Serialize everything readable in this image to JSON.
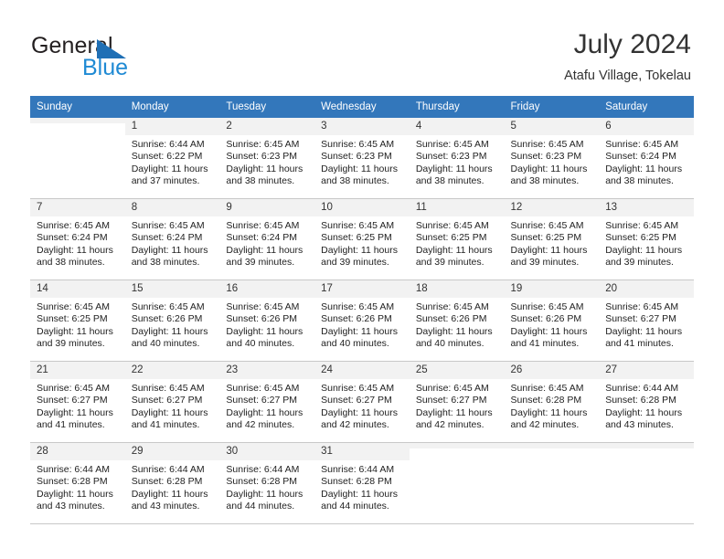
{
  "brand": {
    "name_part1": "General",
    "name_part2": "Blue",
    "logo_icon": "triangle-icon",
    "color_dark": "#231f20",
    "color_blue": "#1f8ad4",
    "triangle_color": "#1f6fb5"
  },
  "header": {
    "title": "July 2024",
    "subtitle": "Atafu Village, Tokelau"
  },
  "theme": {
    "header_row_bg": "#3377bb",
    "daynum_bg": "#f2f2f2",
    "grid_line": "#c8c8c8"
  },
  "weekdays": [
    {
      "label": "Sunday"
    },
    {
      "label": "Monday"
    },
    {
      "label": "Tuesday"
    },
    {
      "label": "Wednesday"
    },
    {
      "label": "Thursday"
    },
    {
      "label": "Friday"
    },
    {
      "label": "Saturday"
    }
  ],
  "weeks": [
    [
      {
        "day": "",
        "empty": true,
        "sunrise": "",
        "sunset": "",
        "daylight_line1": "",
        "daylight_line2": ""
      },
      {
        "day": "1",
        "sunrise": "Sunrise: 6:44 AM",
        "sunset": "Sunset: 6:22 PM",
        "daylight_line1": "Daylight: 11 hours",
        "daylight_line2": "and 37 minutes."
      },
      {
        "day": "2",
        "sunrise": "Sunrise: 6:45 AM",
        "sunset": "Sunset: 6:23 PM",
        "daylight_line1": "Daylight: 11 hours",
        "daylight_line2": "and 38 minutes."
      },
      {
        "day": "3",
        "sunrise": "Sunrise: 6:45 AM",
        "sunset": "Sunset: 6:23 PM",
        "daylight_line1": "Daylight: 11 hours",
        "daylight_line2": "and 38 minutes."
      },
      {
        "day": "4",
        "sunrise": "Sunrise: 6:45 AM",
        "sunset": "Sunset: 6:23 PM",
        "daylight_line1": "Daylight: 11 hours",
        "daylight_line2": "and 38 minutes."
      },
      {
        "day": "5",
        "sunrise": "Sunrise: 6:45 AM",
        "sunset": "Sunset: 6:23 PM",
        "daylight_line1": "Daylight: 11 hours",
        "daylight_line2": "and 38 minutes."
      },
      {
        "day": "6",
        "sunrise": "Sunrise: 6:45 AM",
        "sunset": "Sunset: 6:24 PM",
        "daylight_line1": "Daylight: 11 hours",
        "daylight_line2": "and 38 minutes."
      }
    ],
    [
      {
        "day": "7",
        "sunrise": "Sunrise: 6:45 AM",
        "sunset": "Sunset: 6:24 PM",
        "daylight_line1": "Daylight: 11 hours",
        "daylight_line2": "and 38 minutes."
      },
      {
        "day": "8",
        "sunrise": "Sunrise: 6:45 AM",
        "sunset": "Sunset: 6:24 PM",
        "daylight_line1": "Daylight: 11 hours",
        "daylight_line2": "and 38 minutes."
      },
      {
        "day": "9",
        "sunrise": "Sunrise: 6:45 AM",
        "sunset": "Sunset: 6:24 PM",
        "daylight_line1": "Daylight: 11 hours",
        "daylight_line2": "and 39 minutes."
      },
      {
        "day": "10",
        "sunrise": "Sunrise: 6:45 AM",
        "sunset": "Sunset: 6:25 PM",
        "daylight_line1": "Daylight: 11 hours",
        "daylight_line2": "and 39 minutes."
      },
      {
        "day": "11",
        "sunrise": "Sunrise: 6:45 AM",
        "sunset": "Sunset: 6:25 PM",
        "daylight_line1": "Daylight: 11 hours",
        "daylight_line2": "and 39 minutes."
      },
      {
        "day": "12",
        "sunrise": "Sunrise: 6:45 AM",
        "sunset": "Sunset: 6:25 PM",
        "daylight_line1": "Daylight: 11 hours",
        "daylight_line2": "and 39 minutes."
      },
      {
        "day": "13",
        "sunrise": "Sunrise: 6:45 AM",
        "sunset": "Sunset: 6:25 PM",
        "daylight_line1": "Daylight: 11 hours",
        "daylight_line2": "and 39 minutes."
      }
    ],
    [
      {
        "day": "14",
        "sunrise": "Sunrise: 6:45 AM",
        "sunset": "Sunset: 6:25 PM",
        "daylight_line1": "Daylight: 11 hours",
        "daylight_line2": "and 39 minutes."
      },
      {
        "day": "15",
        "sunrise": "Sunrise: 6:45 AM",
        "sunset": "Sunset: 6:26 PM",
        "daylight_line1": "Daylight: 11 hours",
        "daylight_line2": "and 40 minutes."
      },
      {
        "day": "16",
        "sunrise": "Sunrise: 6:45 AM",
        "sunset": "Sunset: 6:26 PM",
        "daylight_line1": "Daylight: 11 hours",
        "daylight_line2": "and 40 minutes."
      },
      {
        "day": "17",
        "sunrise": "Sunrise: 6:45 AM",
        "sunset": "Sunset: 6:26 PM",
        "daylight_line1": "Daylight: 11 hours",
        "daylight_line2": "and 40 minutes."
      },
      {
        "day": "18",
        "sunrise": "Sunrise: 6:45 AM",
        "sunset": "Sunset: 6:26 PM",
        "daylight_line1": "Daylight: 11 hours",
        "daylight_line2": "and 40 minutes."
      },
      {
        "day": "19",
        "sunrise": "Sunrise: 6:45 AM",
        "sunset": "Sunset: 6:26 PM",
        "daylight_line1": "Daylight: 11 hours",
        "daylight_line2": "and 41 minutes."
      },
      {
        "day": "20",
        "sunrise": "Sunrise: 6:45 AM",
        "sunset": "Sunset: 6:27 PM",
        "daylight_line1": "Daylight: 11 hours",
        "daylight_line2": "and 41 minutes."
      }
    ],
    [
      {
        "day": "21",
        "sunrise": "Sunrise: 6:45 AM",
        "sunset": "Sunset: 6:27 PM",
        "daylight_line1": "Daylight: 11 hours",
        "daylight_line2": "and 41 minutes."
      },
      {
        "day": "22",
        "sunrise": "Sunrise: 6:45 AM",
        "sunset": "Sunset: 6:27 PM",
        "daylight_line1": "Daylight: 11 hours",
        "daylight_line2": "and 41 minutes."
      },
      {
        "day": "23",
        "sunrise": "Sunrise: 6:45 AM",
        "sunset": "Sunset: 6:27 PM",
        "daylight_line1": "Daylight: 11 hours",
        "daylight_line2": "and 42 minutes."
      },
      {
        "day": "24",
        "sunrise": "Sunrise: 6:45 AM",
        "sunset": "Sunset: 6:27 PM",
        "daylight_line1": "Daylight: 11 hours",
        "daylight_line2": "and 42 minutes."
      },
      {
        "day": "25",
        "sunrise": "Sunrise: 6:45 AM",
        "sunset": "Sunset: 6:27 PM",
        "daylight_line1": "Daylight: 11 hours",
        "daylight_line2": "and 42 minutes."
      },
      {
        "day": "26",
        "sunrise": "Sunrise: 6:45 AM",
        "sunset": "Sunset: 6:28 PM",
        "daylight_line1": "Daylight: 11 hours",
        "daylight_line2": "and 42 minutes."
      },
      {
        "day": "27",
        "sunrise": "Sunrise: 6:44 AM",
        "sunset": "Sunset: 6:28 PM",
        "daylight_line1": "Daylight: 11 hours",
        "daylight_line2": "and 43 minutes."
      }
    ],
    [
      {
        "day": "28",
        "sunrise": "Sunrise: 6:44 AM",
        "sunset": "Sunset: 6:28 PM",
        "daylight_line1": "Daylight: 11 hours",
        "daylight_line2": "and 43 minutes."
      },
      {
        "day": "29",
        "sunrise": "Sunrise: 6:44 AM",
        "sunset": "Sunset: 6:28 PM",
        "daylight_line1": "Daylight: 11 hours",
        "daylight_line2": "and 43 minutes."
      },
      {
        "day": "30",
        "sunrise": "Sunrise: 6:44 AM",
        "sunset": "Sunset: 6:28 PM",
        "daylight_line1": "Daylight: 11 hours",
        "daylight_line2": "and 44 minutes."
      },
      {
        "day": "31",
        "sunrise": "Sunrise: 6:44 AM",
        "sunset": "Sunset: 6:28 PM",
        "daylight_line1": "Daylight: 11 hours",
        "daylight_line2": "and 44 minutes."
      },
      {
        "day": "",
        "empty": true,
        "sunrise": "",
        "sunset": "",
        "daylight_line1": "",
        "daylight_line2": ""
      },
      {
        "day": "",
        "empty": true,
        "sunrise": "",
        "sunset": "",
        "daylight_line1": "",
        "daylight_line2": ""
      },
      {
        "day": "",
        "empty": true,
        "sunrise": "",
        "sunset": "",
        "daylight_line1": "",
        "daylight_line2": ""
      }
    ]
  ]
}
